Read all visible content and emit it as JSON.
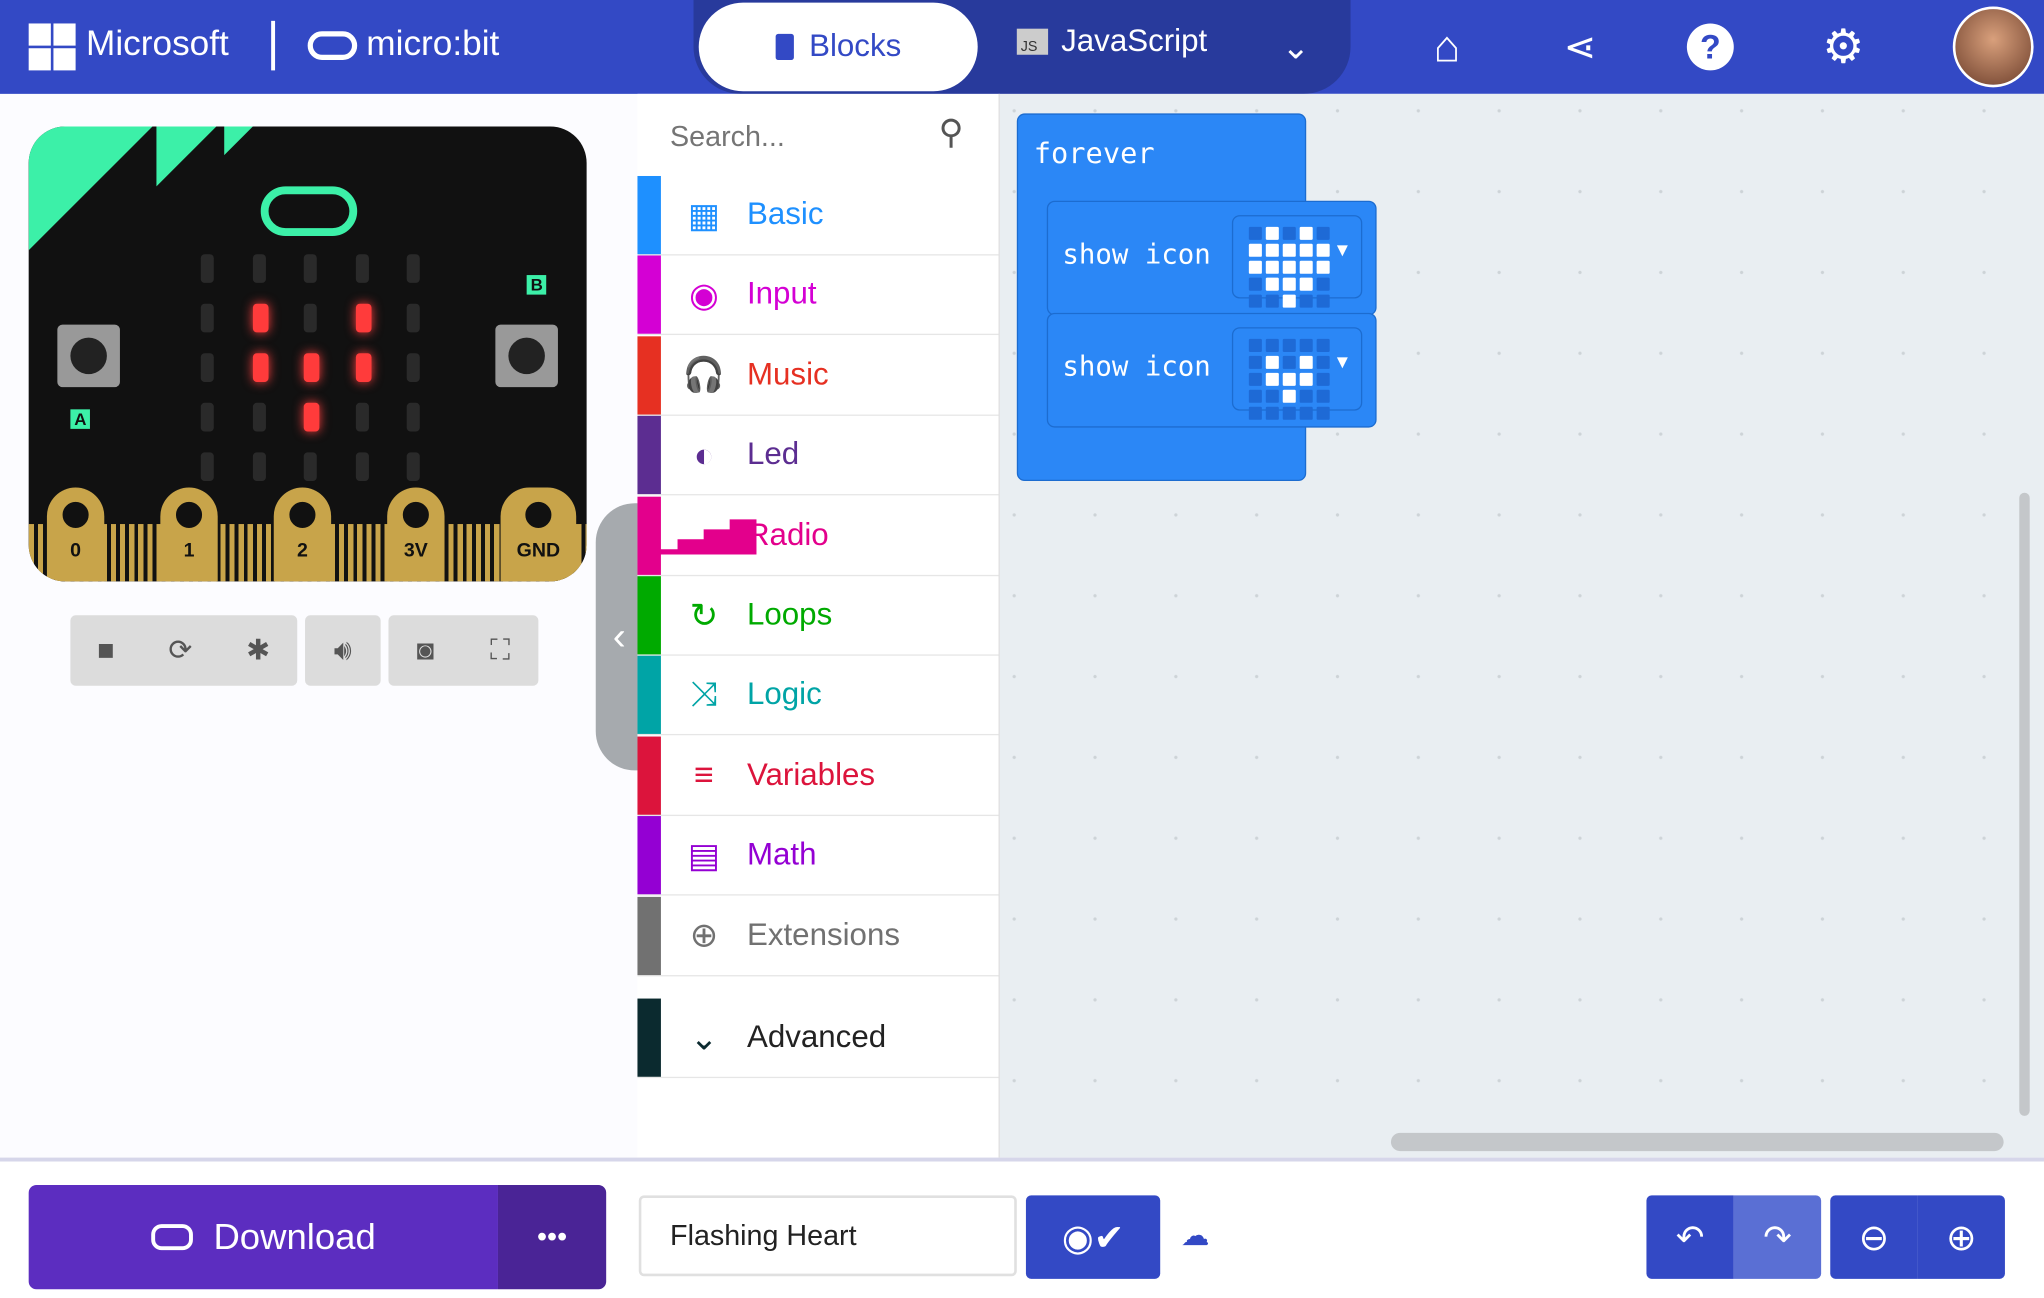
{
  "header": {
    "brand": "Microsoft",
    "product": "micro:bit",
    "tabs": {
      "blocks": "Blocks",
      "javascript": "JavaScript",
      "js_badge": "JS"
    },
    "accent": "#3349c5"
  },
  "search": {
    "placeholder": "Search..."
  },
  "categories": [
    {
      "label": "Basic",
      "color": "#1e90ff",
      "icon": "grid-icon",
      "glyph": "▦"
    },
    {
      "label": "Input",
      "color": "#d400d4",
      "icon": "input-icon",
      "glyph": "◉"
    },
    {
      "label": "Music",
      "color": "#e63022",
      "icon": "headphones-icon",
      "glyph": "🎧"
    },
    {
      "label": "Led",
      "color": "#5c2d91",
      "icon": "toggle-icon",
      "glyph": "◐"
    },
    {
      "label": "Radio",
      "color": "#e3008c",
      "icon": "signal-icon",
      "glyph": "▁▃▅▇"
    },
    {
      "label": "Loops",
      "color": "#00aa00",
      "icon": "loop-icon",
      "glyph": "↻"
    },
    {
      "label": "Logic",
      "color": "#00a4a6",
      "icon": "shuffle-icon",
      "glyph": "⤨"
    },
    {
      "label": "Variables",
      "color": "#dc143c",
      "icon": "list-icon",
      "glyph": "≡"
    },
    {
      "label": "Math",
      "color": "#9400d3",
      "icon": "calculator-icon",
      "glyph": "▤"
    },
    {
      "label": "Extensions",
      "color": "#717171",
      "icon": "plus-circle-icon",
      "glyph": "⊕"
    },
    {
      "label": "Advanced",
      "color": "#0b2a2f",
      "icon": "chevron-down-icon",
      "glyph": "⌄"
    }
  ],
  "simulator": {
    "pins": [
      "0",
      "1",
      "2",
      "3V",
      "GND"
    ],
    "button_a": "A",
    "button_b": "B",
    "leds": [
      [
        0,
        0,
        0,
        0,
        0
      ],
      [
        0,
        1,
        0,
        1,
        0
      ],
      [
        0,
        1,
        1,
        1,
        0
      ],
      [
        0,
        0,
        1,
        0,
        0
      ],
      [
        0,
        0,
        0,
        0,
        0
      ]
    ]
  },
  "blocks": {
    "forever": "forever",
    "show_icon_1": "show icon",
    "show_icon_2": "show icon",
    "icon1": [
      [
        0,
        1,
        0,
        1,
        0
      ],
      [
        1,
        1,
        1,
        1,
        1
      ],
      [
        1,
        1,
        1,
        1,
        1
      ],
      [
        0,
        1,
        1,
        1,
        0
      ],
      [
        0,
        0,
        1,
        0,
        0
      ]
    ],
    "icon2": [
      [
        0,
        0,
        0,
        0,
        0
      ],
      [
        0,
        1,
        0,
        1,
        0
      ],
      [
        0,
        1,
        1,
        1,
        0
      ],
      [
        0,
        0,
        1,
        0,
        0
      ],
      [
        0,
        0,
        0,
        0,
        0
      ]
    ]
  },
  "bottom": {
    "download": "Download",
    "more": "•••",
    "project_name": "Flashing Heart"
  }
}
